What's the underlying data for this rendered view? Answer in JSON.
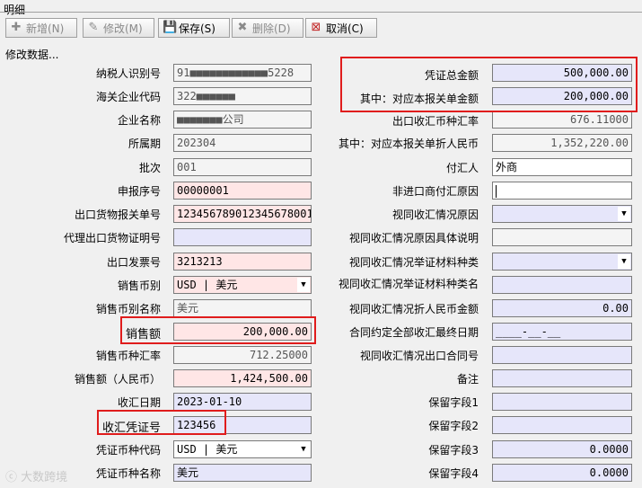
{
  "window": {
    "title": "明细"
  },
  "toolbar": {
    "add": "新增(N)",
    "edit": "修改(M)",
    "save": "保存(S)",
    "delete": "删除(D)",
    "cancel": "取消(C)"
  },
  "status": "修改数据...",
  "left": [
    {
      "label": "纳税人识别号",
      "value": "91■■■■■■■■■■■■5228"
    },
    {
      "label": "海关企业代码",
      "value": "322■■■■■■"
    },
    {
      "label": "企业名称",
      "value": "■■■■■■■公司"
    },
    {
      "label": "所属期",
      "value": "202304"
    },
    {
      "label": "批次",
      "value": "001"
    },
    {
      "label": "申报序号",
      "value": "00000001"
    },
    {
      "label": "出口货物报关单号",
      "value": "123456789012345678001"
    },
    {
      "label": "代理出口货物证明号",
      "value": ""
    },
    {
      "label": "出口发票号",
      "value": "3213213"
    },
    {
      "label": "销售币别",
      "value": "USD | 美元"
    },
    {
      "label": "销售币别名称",
      "value": "美元"
    },
    {
      "label": "销售额",
      "value": "200,000.00"
    },
    {
      "label": "销售币种汇率",
      "value": "712.25000"
    },
    {
      "label": "销售额（人民币）",
      "value": "1,424,500.00"
    },
    {
      "label": "收汇日期",
      "value": "2023-01-10"
    },
    {
      "label": "收汇凭证号",
      "value": "123456"
    },
    {
      "label": "凭证币种代码",
      "value": "USD | 美元"
    },
    {
      "label": "凭证币种名称",
      "value": "美元"
    }
  ],
  "right": [
    {
      "label": "凭证总金额",
      "value": "500,000.00"
    },
    {
      "label": "其中：对应本报关单金额",
      "value": "200,000.00"
    },
    {
      "label": "出口收汇币种汇率",
      "value": "676.11000"
    },
    {
      "label": "其中：对应本报关单折人民币",
      "value": "1,352,220.00"
    },
    {
      "label": "付汇人",
      "value": "外商"
    },
    {
      "label": "非进口商付汇原因",
      "value": ""
    },
    {
      "label": "视同收汇情况原因",
      "value": ""
    },
    {
      "label": "视同收汇情况原因具体说明",
      "value": ""
    },
    {
      "label": "视同收汇情况举证材料种类",
      "value": ""
    },
    {
      "label": "视同收汇情况举证材料种类名",
      "value": ""
    },
    {
      "label": "视同收汇情况折人民币金额",
      "value": "0.00"
    },
    {
      "label": "合同约定全部收汇最终日期",
      "value": "____-__-__"
    },
    {
      "label": "视同收汇情况出口合同号",
      "value": ""
    },
    {
      "label": "备注",
      "value": ""
    },
    {
      "label": "保留字段1",
      "value": ""
    },
    {
      "label": "保留字段2",
      "value": ""
    },
    {
      "label": "保留字段3",
      "value": "0.0000"
    },
    {
      "label": "保留字段4",
      "value": "0.0000"
    }
  ],
  "watermark": "大数跨境",
  "colors": {
    "highlight": "#e01c1c",
    "required": "#ffe6e6",
    "editable": "#e6e6fa"
  }
}
